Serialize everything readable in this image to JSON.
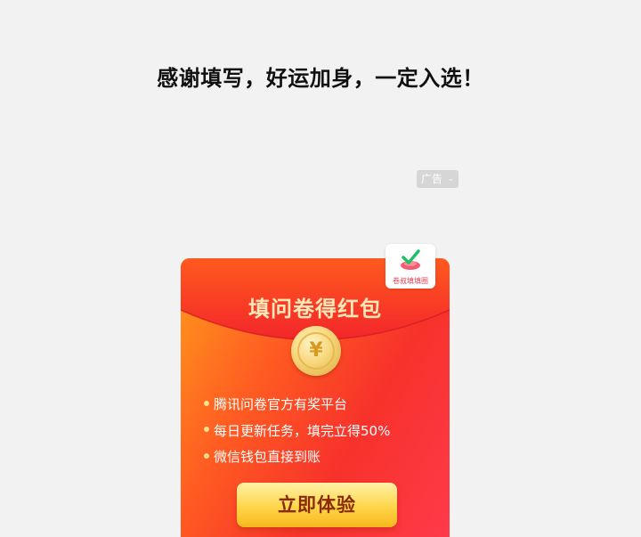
{
  "thanks_message": "感谢填写，好运加身，一定入选！",
  "ad": {
    "label": "广告",
    "chevron": "chevron-down-icon"
  },
  "card": {
    "title": "填问卷得红包",
    "coin_symbol": "¥",
    "bullets": [
      "腾讯问卷官方有奖平台",
      "每日更新任务，填完立得50%",
      "微信钱包直接到账"
    ],
    "cta_label": "立即体验",
    "colors": {
      "primary_red": "#f7322b",
      "orange": "#ff9a1c",
      "gold": "#ffd64a",
      "title_text": "#ffe7b8",
      "cta_text": "#8a2a07"
    }
  },
  "badge": {
    "icon": "check-icon",
    "label": "卷叔填填圈"
  }
}
